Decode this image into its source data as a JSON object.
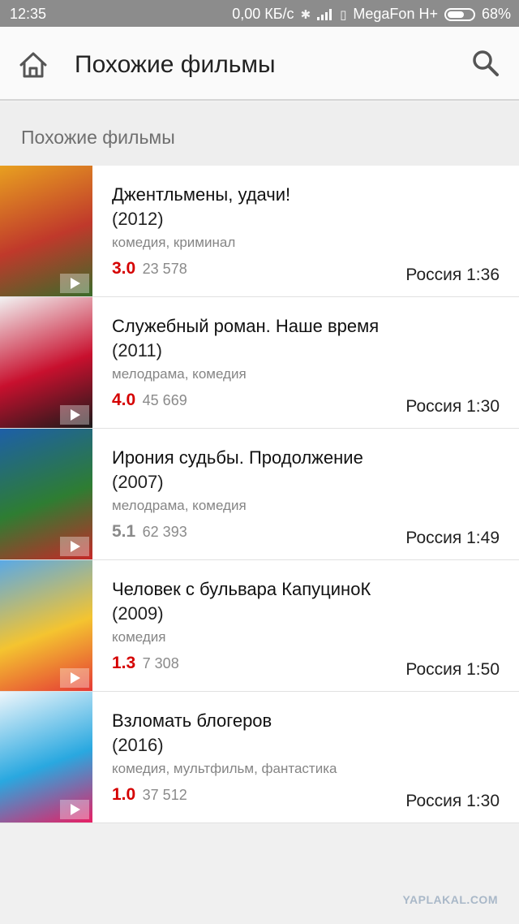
{
  "status_bar": {
    "time": "12:35",
    "speed": "0,00 КБ/с",
    "carrier": "MegaFon H+",
    "battery_percent": "68%",
    "battery_level": 0.68,
    "icons": [
      "bluetooth-icon",
      "signal-icon",
      "signal-off-icon",
      "battery-icon"
    ]
  },
  "app_bar": {
    "title": "Похожие фильмы",
    "home_icon": "home-icon",
    "search_icon": "search-icon"
  },
  "section": {
    "title": "Похожие фильмы"
  },
  "movies": [
    {
      "title": "Джентльмены, удачи!",
      "year": "(2012)",
      "genres": "комедия, криминал",
      "rating": "3.0",
      "votes": "23 578",
      "country_duration": "Россия 1:36",
      "rating_color": "#d50000",
      "poster_colors": [
        "#e8a020",
        "#c0392b",
        "#3a6b2a"
      ]
    },
    {
      "title": "Служебный роман. Наше время",
      "year": "(2011)",
      "genres": "мелодрама, комедия",
      "rating": "4.0",
      "votes": "45 669",
      "country_duration": "Россия 1:30",
      "rating_color": "#d50000",
      "poster_colors": [
        "#f2f2f2",
        "#c8102e",
        "#1a1a1a"
      ]
    },
    {
      "title": "Ирония судьбы. Продолжение",
      "year": "(2007)",
      "genres": "мелодрама, комедия",
      "rating": "5.1",
      "votes": "62 393",
      "country_duration": "Россия 1:49",
      "rating_color": "#8a8a8a",
      "poster_colors": [
        "#1d5fa8",
        "#2e7d32",
        "#c62828"
      ]
    },
    {
      "title": "Человек с бульвара КапуциноК",
      "year": "(2009)",
      "genres": "комедия",
      "rating": "1.3",
      "votes": "7 308",
      "country_duration": "Россия 1:50",
      "rating_color": "#d50000",
      "poster_colors": [
        "#5aa9e6",
        "#f4c430",
        "#e53935"
      ]
    },
    {
      "title": "Взломать блогеров",
      "year": "(2016)",
      "genres": "комедия, мультфильм, фантастика",
      "rating": "1.0",
      "votes": "37 512",
      "country_duration": "Россия 1:30",
      "rating_color": "#d50000",
      "poster_colors": [
        "#eef6fb",
        "#29a8e0",
        "#e91e63"
      ]
    }
  ],
  "watermark": "YAPLAKAL.COM"
}
